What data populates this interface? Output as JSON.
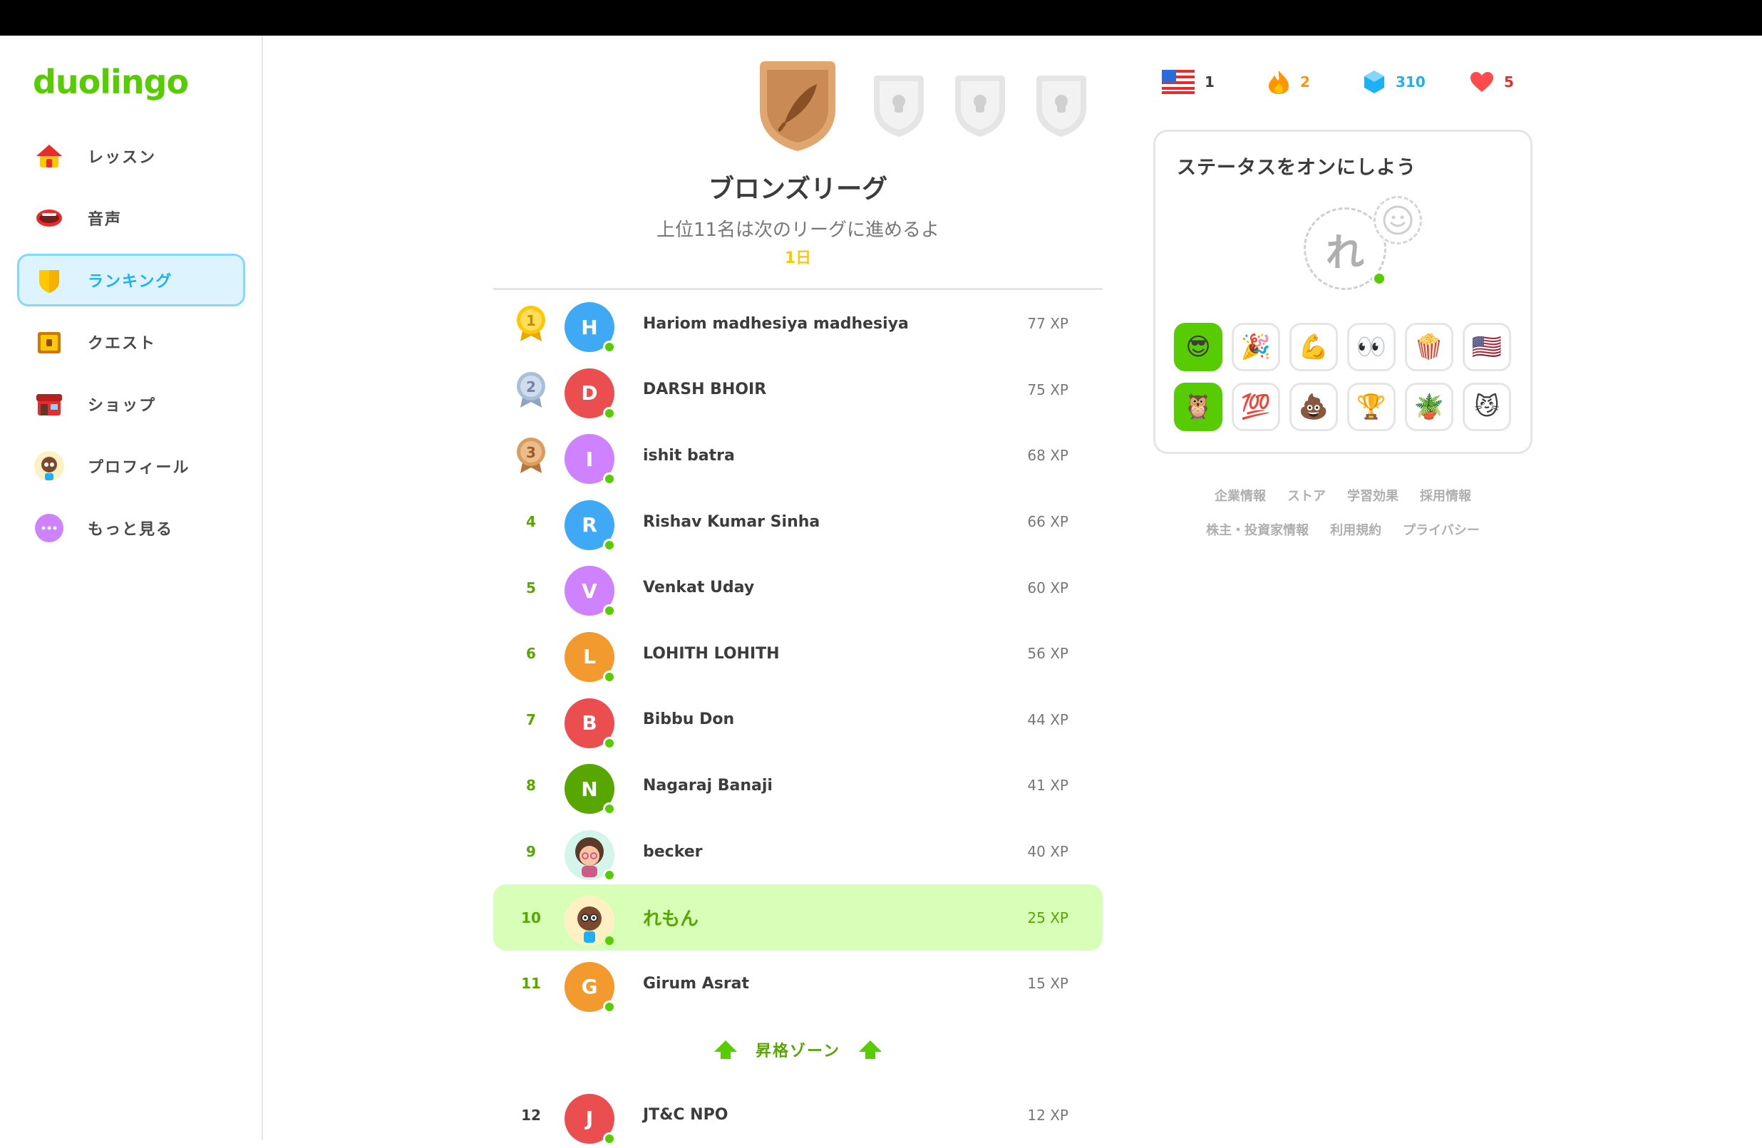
{
  "app": {
    "logo": "duolingo"
  },
  "sidebar": {
    "items": [
      {
        "label": "レッスン",
        "icon": "home-icon"
      },
      {
        "label": "音声",
        "icon": "mouth-icon"
      },
      {
        "label": "ランキング",
        "icon": "shield-icon",
        "active": true
      },
      {
        "label": "クエスト",
        "icon": "chest-icon"
      },
      {
        "label": "ショップ",
        "icon": "shop-icon"
      },
      {
        "label": "プロフィール",
        "icon": "profile-avatar-icon"
      },
      {
        "label": "もっと見る",
        "icon": "more-icon"
      }
    ]
  },
  "league": {
    "title": "ブロンズリーグ",
    "subtitle": "上位11名は次のリーグに進めるよ",
    "time_left": "1日"
  },
  "leaderboard": {
    "rows": [
      {
        "rank": "1",
        "initial": "H",
        "color": "#3fa9f5",
        "name": "Hariom madhesiya madhesiya",
        "xp": "77 XP"
      },
      {
        "rank": "2",
        "initial": "D",
        "color": "#ea4e4e",
        "name": "DARSH BHOIR",
        "xp": "75 XP"
      },
      {
        "rank": "3",
        "initial": "I",
        "color": "#ce82ff",
        "name": "ishit batra",
        "xp": "68 XP"
      },
      {
        "rank": "4",
        "initial": "R",
        "color": "#3fa9f5",
        "name": "Rishav Kumar Sinha",
        "xp": "66 XP"
      },
      {
        "rank": "5",
        "initial": "V",
        "color": "#ce82ff",
        "name": "Venkat Uday",
        "xp": "60 XP"
      },
      {
        "rank": "6",
        "initial": "L",
        "color": "#f29a2e",
        "name": "LOHITH LOHITH",
        "xp": "56 XP"
      },
      {
        "rank": "7",
        "initial": "B",
        "color": "#ea4e4e",
        "name": "Bibbu Don",
        "xp": "44 XP"
      },
      {
        "rank": "8",
        "initial": "N",
        "color": "#58a700",
        "name": "Nagaraj Banaji",
        "xp": "41 XP"
      },
      {
        "rank": "9",
        "initial": "",
        "color": "#d4f5e9",
        "name": "becker",
        "xp": "40 XP"
      },
      {
        "rank": "10",
        "initial": "",
        "color": "#fff1c4",
        "name": "れもん",
        "xp": "25 XP",
        "me": true
      },
      {
        "rank": "11",
        "initial": "G",
        "color": "#f29a2e",
        "name": "Girum Asrat",
        "xp": "15 XP"
      }
    ],
    "promotion_zone": "昇格ゾーン",
    "below": [
      {
        "rank": "12",
        "initial": "J",
        "color": "#ea4e4e",
        "name": "JT&C NPO",
        "xp": "12 XP"
      }
    ]
  },
  "stats": {
    "language_count": "1",
    "streak": "2",
    "gems": "310",
    "hearts": "5"
  },
  "status": {
    "title": "ステータスをオンにしよう",
    "avatar_letter": "れ",
    "emojis": [
      "😎",
      "🎉",
      "💪",
      "👀",
      "🍿",
      "🇺🇸",
      "🦉",
      "💯",
      "💩",
      "🏆",
      "🪴",
      "😼"
    ]
  },
  "footer": {
    "row1": [
      "企業情報",
      "ストア",
      "学習効果",
      "採用情報"
    ],
    "row2": [
      "株主・投資家情報",
      "利用規約",
      "プライバシー"
    ]
  },
  "colors": {
    "brand_green": "#58cc02",
    "active_blue": "#1cb0f6",
    "me_highlight": "#d7ffb8"
  }
}
